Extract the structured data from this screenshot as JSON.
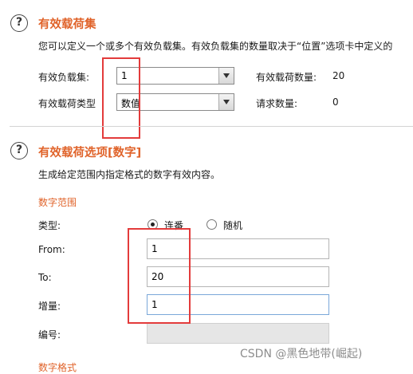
{
  "section1": {
    "title": "有效载荷集",
    "description": "您可以定义一个或多个有效负载集。有效负载集的数量取决于“位置”选项卡中定义的",
    "payload_set_label": "有效负载集:",
    "payload_set_value": "1",
    "payload_count_label": "有效载荷数量:",
    "payload_count_value": "20",
    "payload_type_label": "有效载荷类型",
    "payload_type_value": "数值",
    "request_count_label": "请求数量:",
    "request_count_value": "0"
  },
  "section2": {
    "title": "有效载荷选项[数字]",
    "description": "生成给定范围内指定格式的数字有效内容。",
    "range_heading": "数字范围",
    "type_label": "类型:",
    "radio_sequential": "连番",
    "radio_random": "随机",
    "from_label": "From:",
    "from_value": "1",
    "to_label": "To:",
    "to_value": "20",
    "step_label": "增量:",
    "step_value": "1",
    "number_label": "编号:",
    "format_heading": "数字格式"
  },
  "watermark": "CSDN @黑色地带(崛起)",
  "icons": {
    "help": "help-circle-icon",
    "dropdown": "chevron-down-icon"
  },
  "colors": {
    "section_title": "#e0632a",
    "annotation": "#e33b3b",
    "focus": "#7aa7d9"
  }
}
